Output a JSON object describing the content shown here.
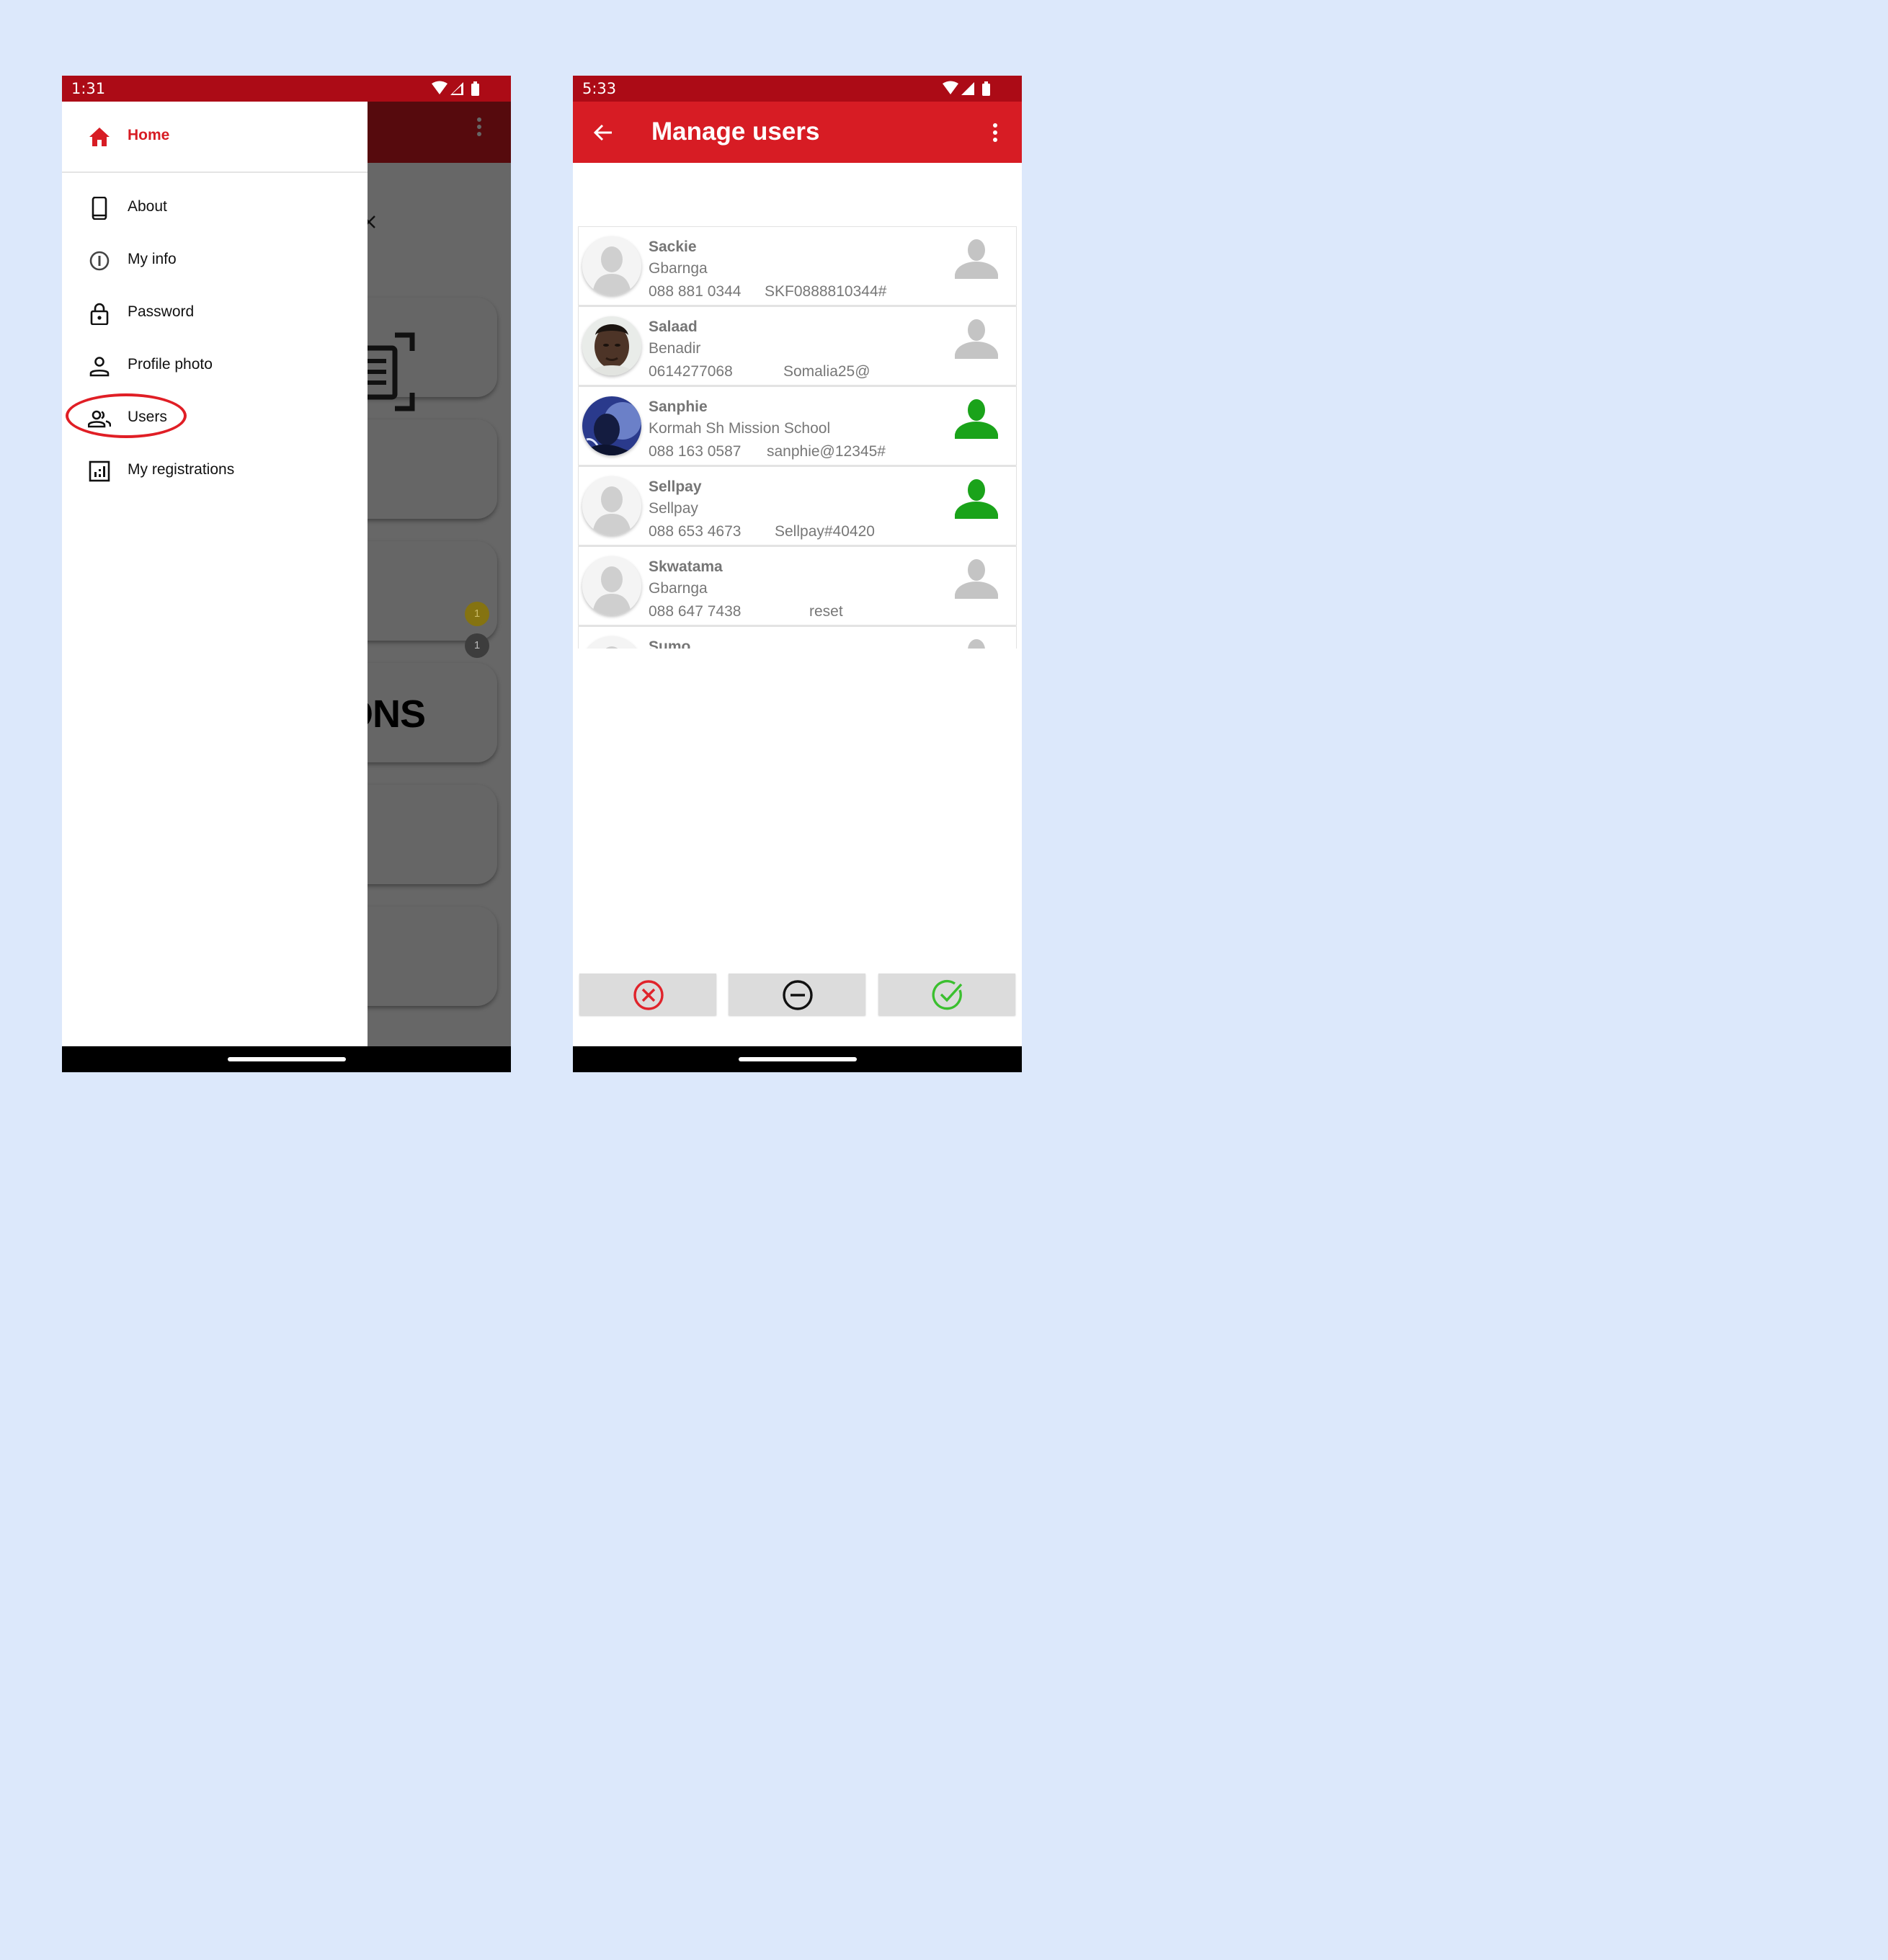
{
  "left_phone": {
    "status_time": "1:31",
    "drawer": {
      "home_label": "Home",
      "items": [
        {
          "label": "About"
        },
        {
          "label": "My info"
        },
        {
          "label": "Password"
        },
        {
          "label": "Profile photo"
        },
        {
          "label": "Users"
        },
        {
          "label": "My registrations"
        }
      ]
    },
    "background": {
      "card_text": "IONS",
      "card_text_2": "S",
      "badge_1": "1",
      "badge_2": "1"
    },
    "colors": {
      "status_bar": "#ac0b16",
      "accent": "#d71c24",
      "highlight_ellipse": "#e01e25"
    }
  },
  "right_phone": {
    "status_time": "5:33",
    "toolbar": {
      "title": "Manage users"
    },
    "users": [
      {
        "name": "Sackie",
        "place": "Gbarnga",
        "phone": "088 881 0344",
        "password": "SKF0888810344#",
        "status": "inactive",
        "avatar": "placeholder"
      },
      {
        "name": "Salaad",
        "place": "Benadir",
        "phone": "0614277068",
        "password": "Somalia25@",
        "status": "inactive",
        "avatar": "photo"
      },
      {
        "name": "Sanphie",
        "place": "Kormah Sh Mission School",
        "phone": "088 163 0587",
        "password": "sanphie@12345#",
        "status": "active",
        "avatar": "photo"
      },
      {
        "name": "Sellpay",
        "place": "Sellpay",
        "phone": "088 653 4673",
        "password": "Sellpay#40420",
        "status": "active",
        "avatar": "placeholder"
      },
      {
        "name": "Skwatama",
        "place": "Gbarnga",
        "phone": "088 647 7438",
        "password": "reset",
        "status": "inactive",
        "avatar": "placeholder"
      },
      {
        "name": "Sumo",
        "place": "",
        "phone": "",
        "password": "",
        "status": "inactive",
        "avatar": "placeholder"
      }
    ],
    "actions": [
      {
        "icon": "cancel-circle-icon",
        "color": "#e0232b"
      },
      {
        "icon": "minus-circle-icon",
        "color": "#111111"
      },
      {
        "icon": "check-circle-icon",
        "color": "#3bbf2f"
      }
    ],
    "colors": {
      "toolbar": "#d71c24",
      "status_active": "#1aa31a",
      "status_inactive": "#c4c4c4"
    }
  }
}
